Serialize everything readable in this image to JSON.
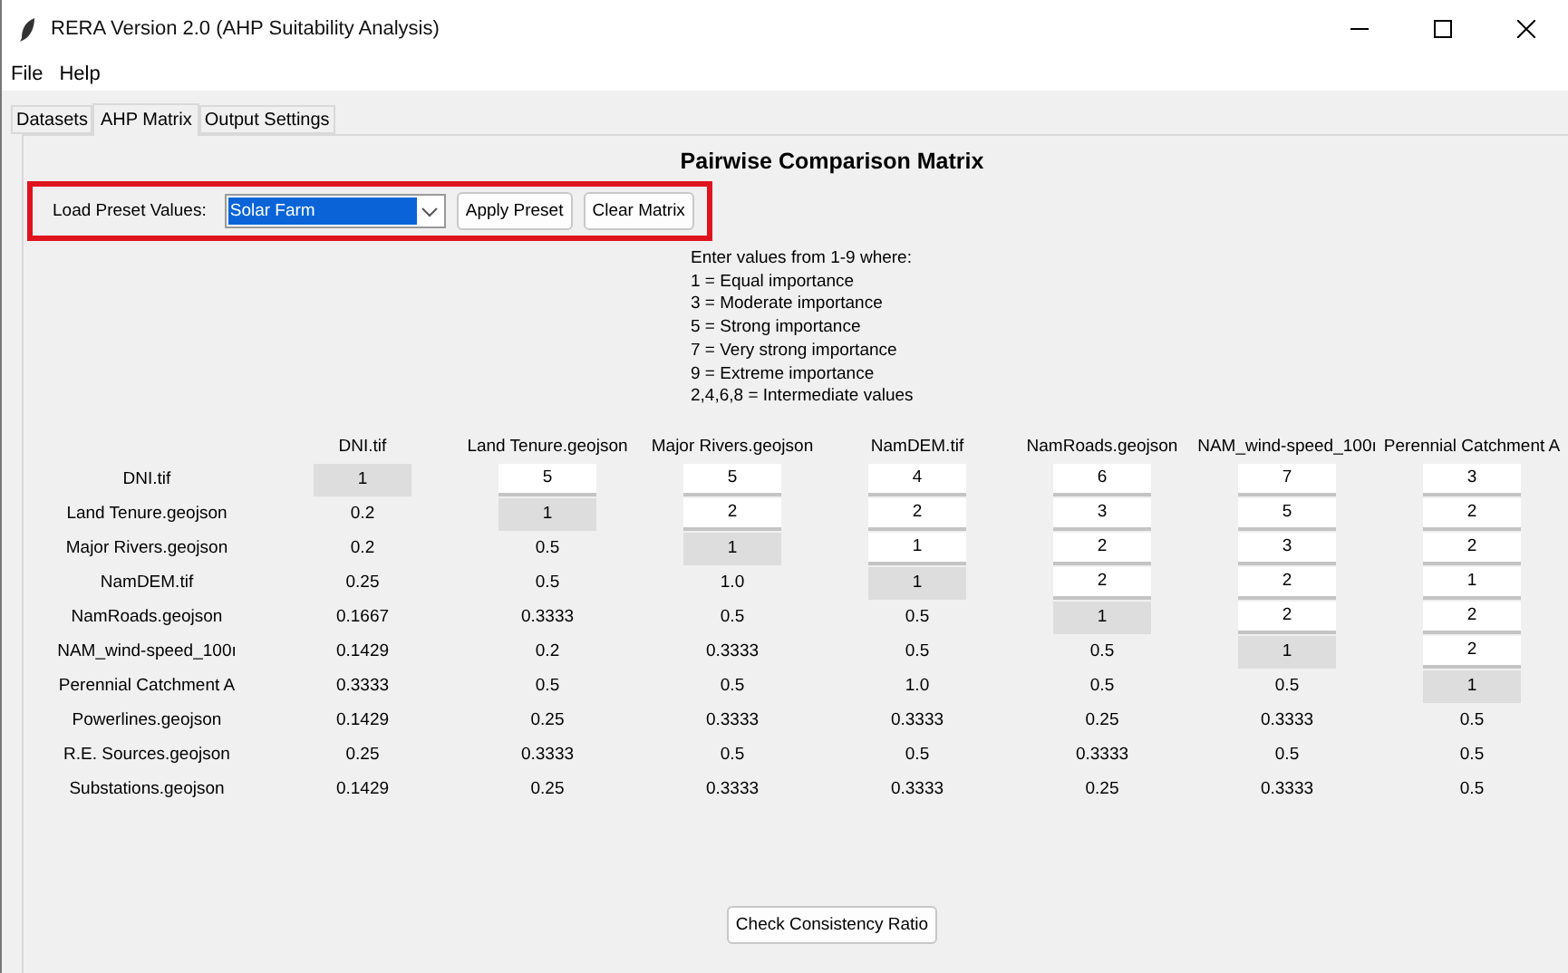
{
  "window": {
    "title": "RERA Version 2.0 (AHP Suitability Analysis)"
  },
  "menu": [
    "File",
    "Help"
  ],
  "tabs": [
    {
      "label": "Datasets",
      "selected": false
    },
    {
      "label": "AHP Matrix",
      "selected": true
    },
    {
      "label": "Output Settings",
      "selected": false
    }
  ],
  "heading": "Pairwise Comparison Matrix",
  "preset": {
    "label": "Load Preset Values:",
    "value": "Solar Farm",
    "buttons": [
      "Apply Preset",
      "Clear Matrix"
    ]
  },
  "instructions": [
    "Enter values from 1-9 where:",
    "1 = Equal importance",
    "3 = Moderate importance",
    "5 = Strong importance",
    "7 = Very strong importance",
    "9 = Extreme importance",
    "2,4,6,8 = Intermediate values"
  ],
  "matrix": {
    "columns": [
      "DNI.tif",
      "Land Tenure.geojson",
      "Major Rivers.geojson",
      "NamDEM.tif",
      "NamRoads.geojson",
      "NAM_wind-speed_100ı",
      "Perennial Catchment A"
    ],
    "rows": [
      {
        "label": "DNI.tif",
        "cells": [
          {
            "kind": "diagonal",
            "value": "1"
          },
          {
            "kind": "input",
            "value": "5"
          },
          {
            "kind": "input",
            "value": "5"
          },
          {
            "kind": "input",
            "value": "4"
          },
          {
            "kind": "input",
            "value": "6"
          },
          {
            "kind": "input",
            "value": "7"
          },
          {
            "kind": "input",
            "value": "3"
          }
        ]
      },
      {
        "label": "Land Tenure.geojson",
        "cells": [
          {
            "kind": "value",
            "value": "0.2"
          },
          {
            "kind": "diagonal",
            "value": "1"
          },
          {
            "kind": "input",
            "value": "2"
          },
          {
            "kind": "input",
            "value": "2"
          },
          {
            "kind": "input",
            "value": "3"
          },
          {
            "kind": "input",
            "value": "5"
          },
          {
            "kind": "input",
            "value": "2"
          }
        ]
      },
      {
        "label": "Major Rivers.geojson",
        "cells": [
          {
            "kind": "value",
            "value": "0.2"
          },
          {
            "kind": "value",
            "value": "0.5"
          },
          {
            "kind": "diagonal",
            "value": "1"
          },
          {
            "kind": "input",
            "value": "1"
          },
          {
            "kind": "input",
            "value": "2"
          },
          {
            "kind": "input",
            "value": "3"
          },
          {
            "kind": "input",
            "value": "2"
          }
        ]
      },
      {
        "label": "NamDEM.tif",
        "cells": [
          {
            "kind": "value",
            "value": "0.25"
          },
          {
            "kind": "value",
            "value": "0.5"
          },
          {
            "kind": "value",
            "value": "1.0"
          },
          {
            "kind": "diagonal",
            "value": "1"
          },
          {
            "kind": "input",
            "value": "2"
          },
          {
            "kind": "input",
            "value": "2"
          },
          {
            "kind": "input",
            "value": "1"
          }
        ]
      },
      {
        "label": "NamRoads.geojson",
        "cells": [
          {
            "kind": "value",
            "value": "0.1667"
          },
          {
            "kind": "value",
            "value": "0.3333"
          },
          {
            "kind": "value",
            "value": "0.5"
          },
          {
            "kind": "value",
            "value": "0.5"
          },
          {
            "kind": "diagonal",
            "value": "1"
          },
          {
            "kind": "input",
            "value": "2"
          },
          {
            "kind": "input",
            "value": "2"
          }
        ]
      },
      {
        "label": "NAM_wind-speed_100ı",
        "cells": [
          {
            "kind": "value",
            "value": "0.1429"
          },
          {
            "kind": "value",
            "value": "0.2"
          },
          {
            "kind": "value",
            "value": "0.3333"
          },
          {
            "kind": "value",
            "value": "0.5"
          },
          {
            "kind": "value",
            "value": "0.5"
          },
          {
            "kind": "diagonal",
            "value": "1"
          },
          {
            "kind": "input",
            "value": "2"
          }
        ]
      },
      {
        "label": "Perennial Catchment A",
        "cells": [
          {
            "kind": "value",
            "value": "0.3333"
          },
          {
            "kind": "value",
            "value": "0.5"
          },
          {
            "kind": "value",
            "value": "0.5"
          },
          {
            "kind": "value",
            "value": "1.0"
          },
          {
            "kind": "value",
            "value": "0.5"
          },
          {
            "kind": "value",
            "value": "0.5"
          },
          {
            "kind": "diagonal",
            "value": "1"
          }
        ]
      },
      {
        "label": "Powerlines.geojson",
        "cells": [
          {
            "kind": "value",
            "value": "0.1429"
          },
          {
            "kind": "value",
            "value": "0.25"
          },
          {
            "kind": "value",
            "value": "0.3333"
          },
          {
            "kind": "value",
            "value": "0.3333"
          },
          {
            "kind": "value",
            "value": "0.25"
          },
          {
            "kind": "value",
            "value": "0.3333"
          },
          {
            "kind": "value",
            "value": "0.5"
          }
        ]
      },
      {
        "label": "R.E. Sources.geojson",
        "cells": [
          {
            "kind": "value",
            "value": "0.25"
          },
          {
            "kind": "value",
            "value": "0.3333"
          },
          {
            "kind": "value",
            "value": "0.5"
          },
          {
            "kind": "value",
            "value": "0.5"
          },
          {
            "kind": "value",
            "value": "0.3333"
          },
          {
            "kind": "value",
            "value": "0.5"
          },
          {
            "kind": "value",
            "value": "0.5"
          }
        ]
      },
      {
        "label": "Substations.geojson",
        "cells": [
          {
            "kind": "value",
            "value": "0.1429"
          },
          {
            "kind": "value",
            "value": "0.25"
          },
          {
            "kind": "value",
            "value": "0.3333"
          },
          {
            "kind": "value",
            "value": "0.3333"
          },
          {
            "kind": "value",
            "value": "0.25"
          },
          {
            "kind": "value",
            "value": "0.3333"
          },
          {
            "kind": "value",
            "value": "0.5"
          }
        ]
      }
    ]
  },
  "check_button": "Check Consistency Ratio"
}
